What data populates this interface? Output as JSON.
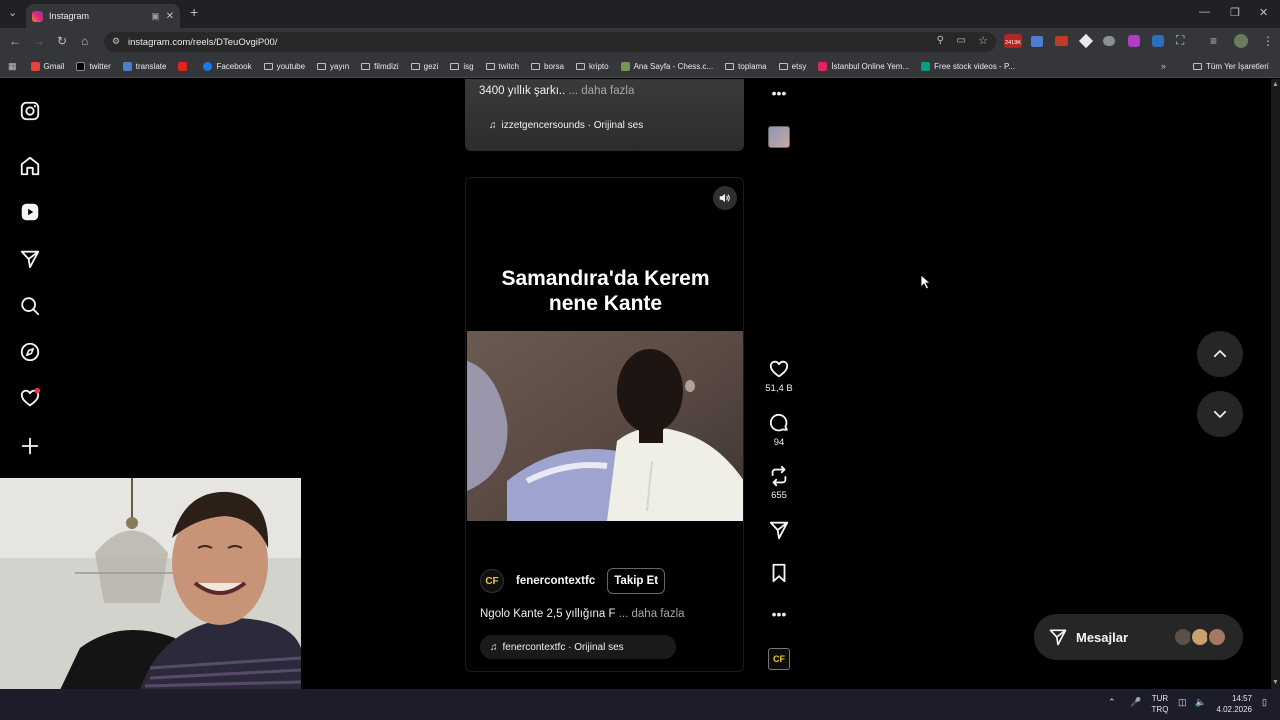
{
  "browser": {
    "tab_title": "Instagram",
    "url": "instagram.com/reels/DTeuOvgiP00/",
    "bookmarks": [
      "Gmail",
      "twitter",
      "translate",
      "Facebook",
      "youtube",
      "yayın",
      "filmdizi",
      "gezi",
      "isg",
      "twitch",
      "borsa",
      "kripto",
      "Ana Sayfa - Chess.c...",
      "toplama",
      "etsy",
      "İstanbul Online Yem...",
      "Free stock videos - P..."
    ],
    "all_bookmarks_label": "Tüm Yer İşaretleri",
    "extension_badge": "2419K"
  },
  "prev_reel": {
    "caption": "3400 yıllık şarkı..",
    "more": " ... daha fazla",
    "audio": "izzetgencersounds · Orijinal ses"
  },
  "reel": {
    "overlay_title_line1": "Samandıra'da Kerem",
    "overlay_title_line2": "nene Kante",
    "author_initials": "CF",
    "author": "fenercontextfc",
    "follow_label": "Takip Et",
    "caption": "Ngolo Kante 2,5 yıllığına F",
    "more": " ... daha fazla",
    "audio": "fenercontextfc · Orijinal ses",
    "likes": "51,4 B",
    "comments": "94",
    "reposts": "655",
    "side_avatar_initials": "CF"
  },
  "messages": {
    "label": "Mesajlar"
  },
  "taskbar": {
    "lang_line1": "TUR",
    "lang_line2": "TRQ",
    "time": "14:57",
    "date": "4.02.2026"
  },
  "colors": {
    "accent_red": "#ff3040",
    "instagram_bg": "#000000"
  }
}
